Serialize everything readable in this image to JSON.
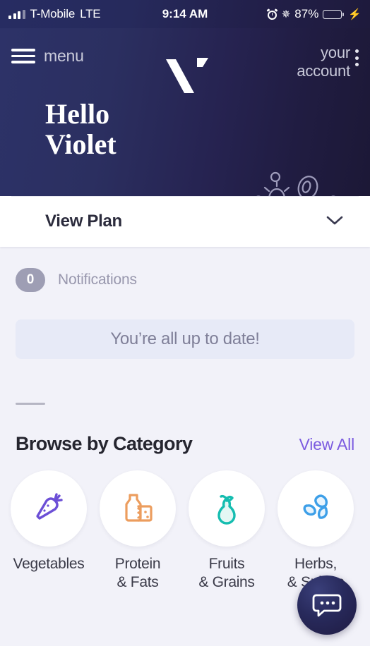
{
  "statusbar": {
    "carrier": "T-Mobile",
    "network": "LTE",
    "time": "9:14 AM",
    "battery_percent": "87%",
    "icons": [
      "signal-bars-icon",
      "alarm-clock-icon",
      "bluetooth-icon",
      "battery-icon",
      "charging-bolt-icon"
    ]
  },
  "header": {
    "menu_label": "menu",
    "account_label_line1": "your",
    "account_label_line2": "account",
    "logo_name": "brand-logo"
  },
  "hero": {
    "greeting_line1": "Hello",
    "greeting_line2": "Violet",
    "background_start": "#2d3268",
    "background_end": "#1c1836",
    "decoration": "microbiome-illustration"
  },
  "plan": {
    "title": "View Plan",
    "expand_icon": "chevron-down-icon"
  },
  "notifications": {
    "count": "0",
    "label": "Notifications",
    "empty_message": "You’re all up to date!"
  },
  "categories_section": {
    "title": "Browse by Category",
    "view_all": "View All",
    "accent_color": "#7c5ce0",
    "items": [
      {
        "label_line1": "Vegetables",
        "label_line2": "",
        "icon": "carrot-icon",
        "color": "#6c4fd6"
      },
      {
        "label_line1": "Protein",
        "label_line2": "& Fats",
        "icon": "milk-bottle-cheese-icon",
        "color": "#ec9d5e"
      },
      {
        "label_line1": "Fruits",
        "label_line2": "& Grains",
        "icon": "pear-icon",
        "color": "#15bdb0"
      },
      {
        "label_line1": "Herbs,",
        "label_line2": "& Spices",
        "icon": "herb-leaves-icon",
        "color": "#3d9fe8"
      }
    ]
  },
  "chat": {
    "icon": "chat-bubble-icon",
    "color": "#282a5c"
  }
}
